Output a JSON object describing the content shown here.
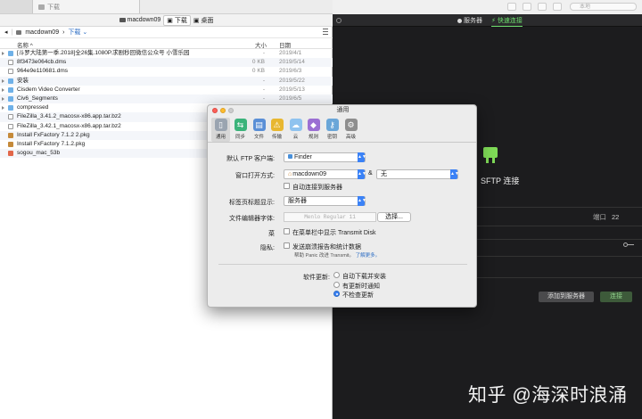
{
  "left_pane": {
    "tabs": [
      "",
      "下载"
    ],
    "location": {
      "host": "macdown09",
      "active_pill": "下载",
      "other_pill": "桌面"
    },
    "path": {
      "root": "macdown09",
      "current": "下载 ⌄"
    },
    "columns": {
      "name": "名称 ^",
      "size": "大小",
      "date": "日期"
    },
    "files": [
      {
        "name": "[斗罗大陆第一季.2018]全26集.1080P.求剧秒回微信公众号 小雪乐园",
        "size": "-",
        "date": "2019/4/1",
        "kind": "folder",
        "expandable": true
      },
      {
        "name": "8f3473e064cb.dms",
        "size": "0 KB",
        "date": "2019/5/14",
        "kind": "doc",
        "expandable": false
      },
      {
        "name": "964e9e110681.dms",
        "size": "0 KB",
        "date": "2019/6/3",
        "kind": "doc",
        "expandable": false
      },
      {
        "name": "安装",
        "size": "-",
        "date": "2019/5/22",
        "kind": "folder",
        "expandable": true
      },
      {
        "name": "Cisdem Video Converter",
        "size": "-",
        "date": "2019/5/13",
        "kind": "folder",
        "expandable": true
      },
      {
        "name": "Civ6_Segments",
        "size": "-",
        "date": "2019/6/5",
        "kind": "folder",
        "expandable": true
      },
      {
        "name": "compressed",
        "size": "-",
        "date": "2019/5/16",
        "kind": "folder",
        "expandable": true
      },
      {
        "name": "FileZilla_3.41.2_macosx-x86.app.tar.bz2",
        "size": "",
        "date": "",
        "kind": "doc",
        "expandable": false
      },
      {
        "name": "FileZilla_3.42.1_macosx-x86.app.tar.bz2",
        "size": "",
        "date": "",
        "kind": "doc",
        "expandable": false
      },
      {
        "name": "Install FxFactory 7.1.2 2.pkg",
        "size": "",
        "date": "",
        "kind": "pkg",
        "expandable": false
      },
      {
        "name": "Install FxFactory 7.1.2.pkg",
        "size": "",
        "date": "",
        "kind": "pkg",
        "expandable": false
      },
      {
        "name": "sogou_mac_53b",
        "size": "",
        "date": "",
        "kind": "img",
        "expandable": false
      }
    ]
  },
  "right_pane": {
    "tabs": {
      "servers": "服务器",
      "quick_connect": "⚡ 快速连接"
    },
    "search_placeholder": "本地",
    "sftp_label": "SFTP 连接",
    "port_label": "端口",
    "port_value": "22",
    "add_button": "添加到服务器",
    "connect_button": "连接"
  },
  "dialog": {
    "title": "通用",
    "toolbar": [
      {
        "label": "通用",
        "icon": "general-icon",
        "glyph": "▯",
        "color": "#9aa4b0",
        "selected": true
      },
      {
        "label": "同步",
        "icon": "sync-icon",
        "glyph": "⇆",
        "color": "#3bb37a",
        "selected": false
      },
      {
        "label": "文件",
        "icon": "files-icon",
        "glyph": "▤",
        "color": "#5a8fd6",
        "selected": false
      },
      {
        "label": "传输",
        "icon": "transfer-icon",
        "glyph": "⚠",
        "color": "#e8b730",
        "selected": false
      },
      {
        "label": "云",
        "icon": "cloud-icon",
        "glyph": "☁",
        "color": "#8fc3ef",
        "selected": false
      },
      {
        "label": "规则",
        "icon": "rules-icon",
        "glyph": "◆",
        "color": "#9b6fd3",
        "selected": false
      },
      {
        "label": "密钥",
        "icon": "key-icon",
        "glyph": "⚷",
        "color": "#6aa6d8",
        "selected": false
      },
      {
        "label": "高级",
        "icon": "advanced-icon",
        "glyph": "⚙",
        "color": "#8e8e8e",
        "selected": false
      }
    ],
    "default_ftp_client": {
      "label": "默认 FTP 客户端:",
      "value": "Finder"
    },
    "open_window": {
      "label": "窗口打开方式:",
      "value": "macdown09",
      "amp": "&",
      "second": "无"
    },
    "auto_connect": {
      "label": "自动连接到服务器",
      "checked": false
    },
    "tab_title": {
      "label": "标签页标题显示:",
      "value": "服务器"
    },
    "editor_font": {
      "label": "文件编辑器字体:",
      "value": "Menlo Regular 11",
      "button": "选择..."
    },
    "menu_bar": {
      "label_prefix": "菜",
      "text": "在菜单栏中显示 Transmit Disk",
      "checked": false
    },
    "privacy": {
      "label": "隐私:",
      "text": "发送崩溃报告和统计数据",
      "checked": false
    },
    "help": {
      "text": "帮助 Panic 改进 Transmit。",
      "link": "了解更多。"
    },
    "updates": {
      "label": "软件更新:",
      "options": [
        {
          "text": "自动下载并安装",
          "selected": false
        },
        {
          "text": "有更新时通知",
          "selected": false
        },
        {
          "text": "不检查更新",
          "selected": true
        }
      ]
    }
  },
  "watermark": "知乎 @海深时浪涌",
  "colors": {
    "accent_green": "#6ee06e",
    "selection_blue": "#3b82f6",
    "dark_bg": "#1c1c1e"
  }
}
